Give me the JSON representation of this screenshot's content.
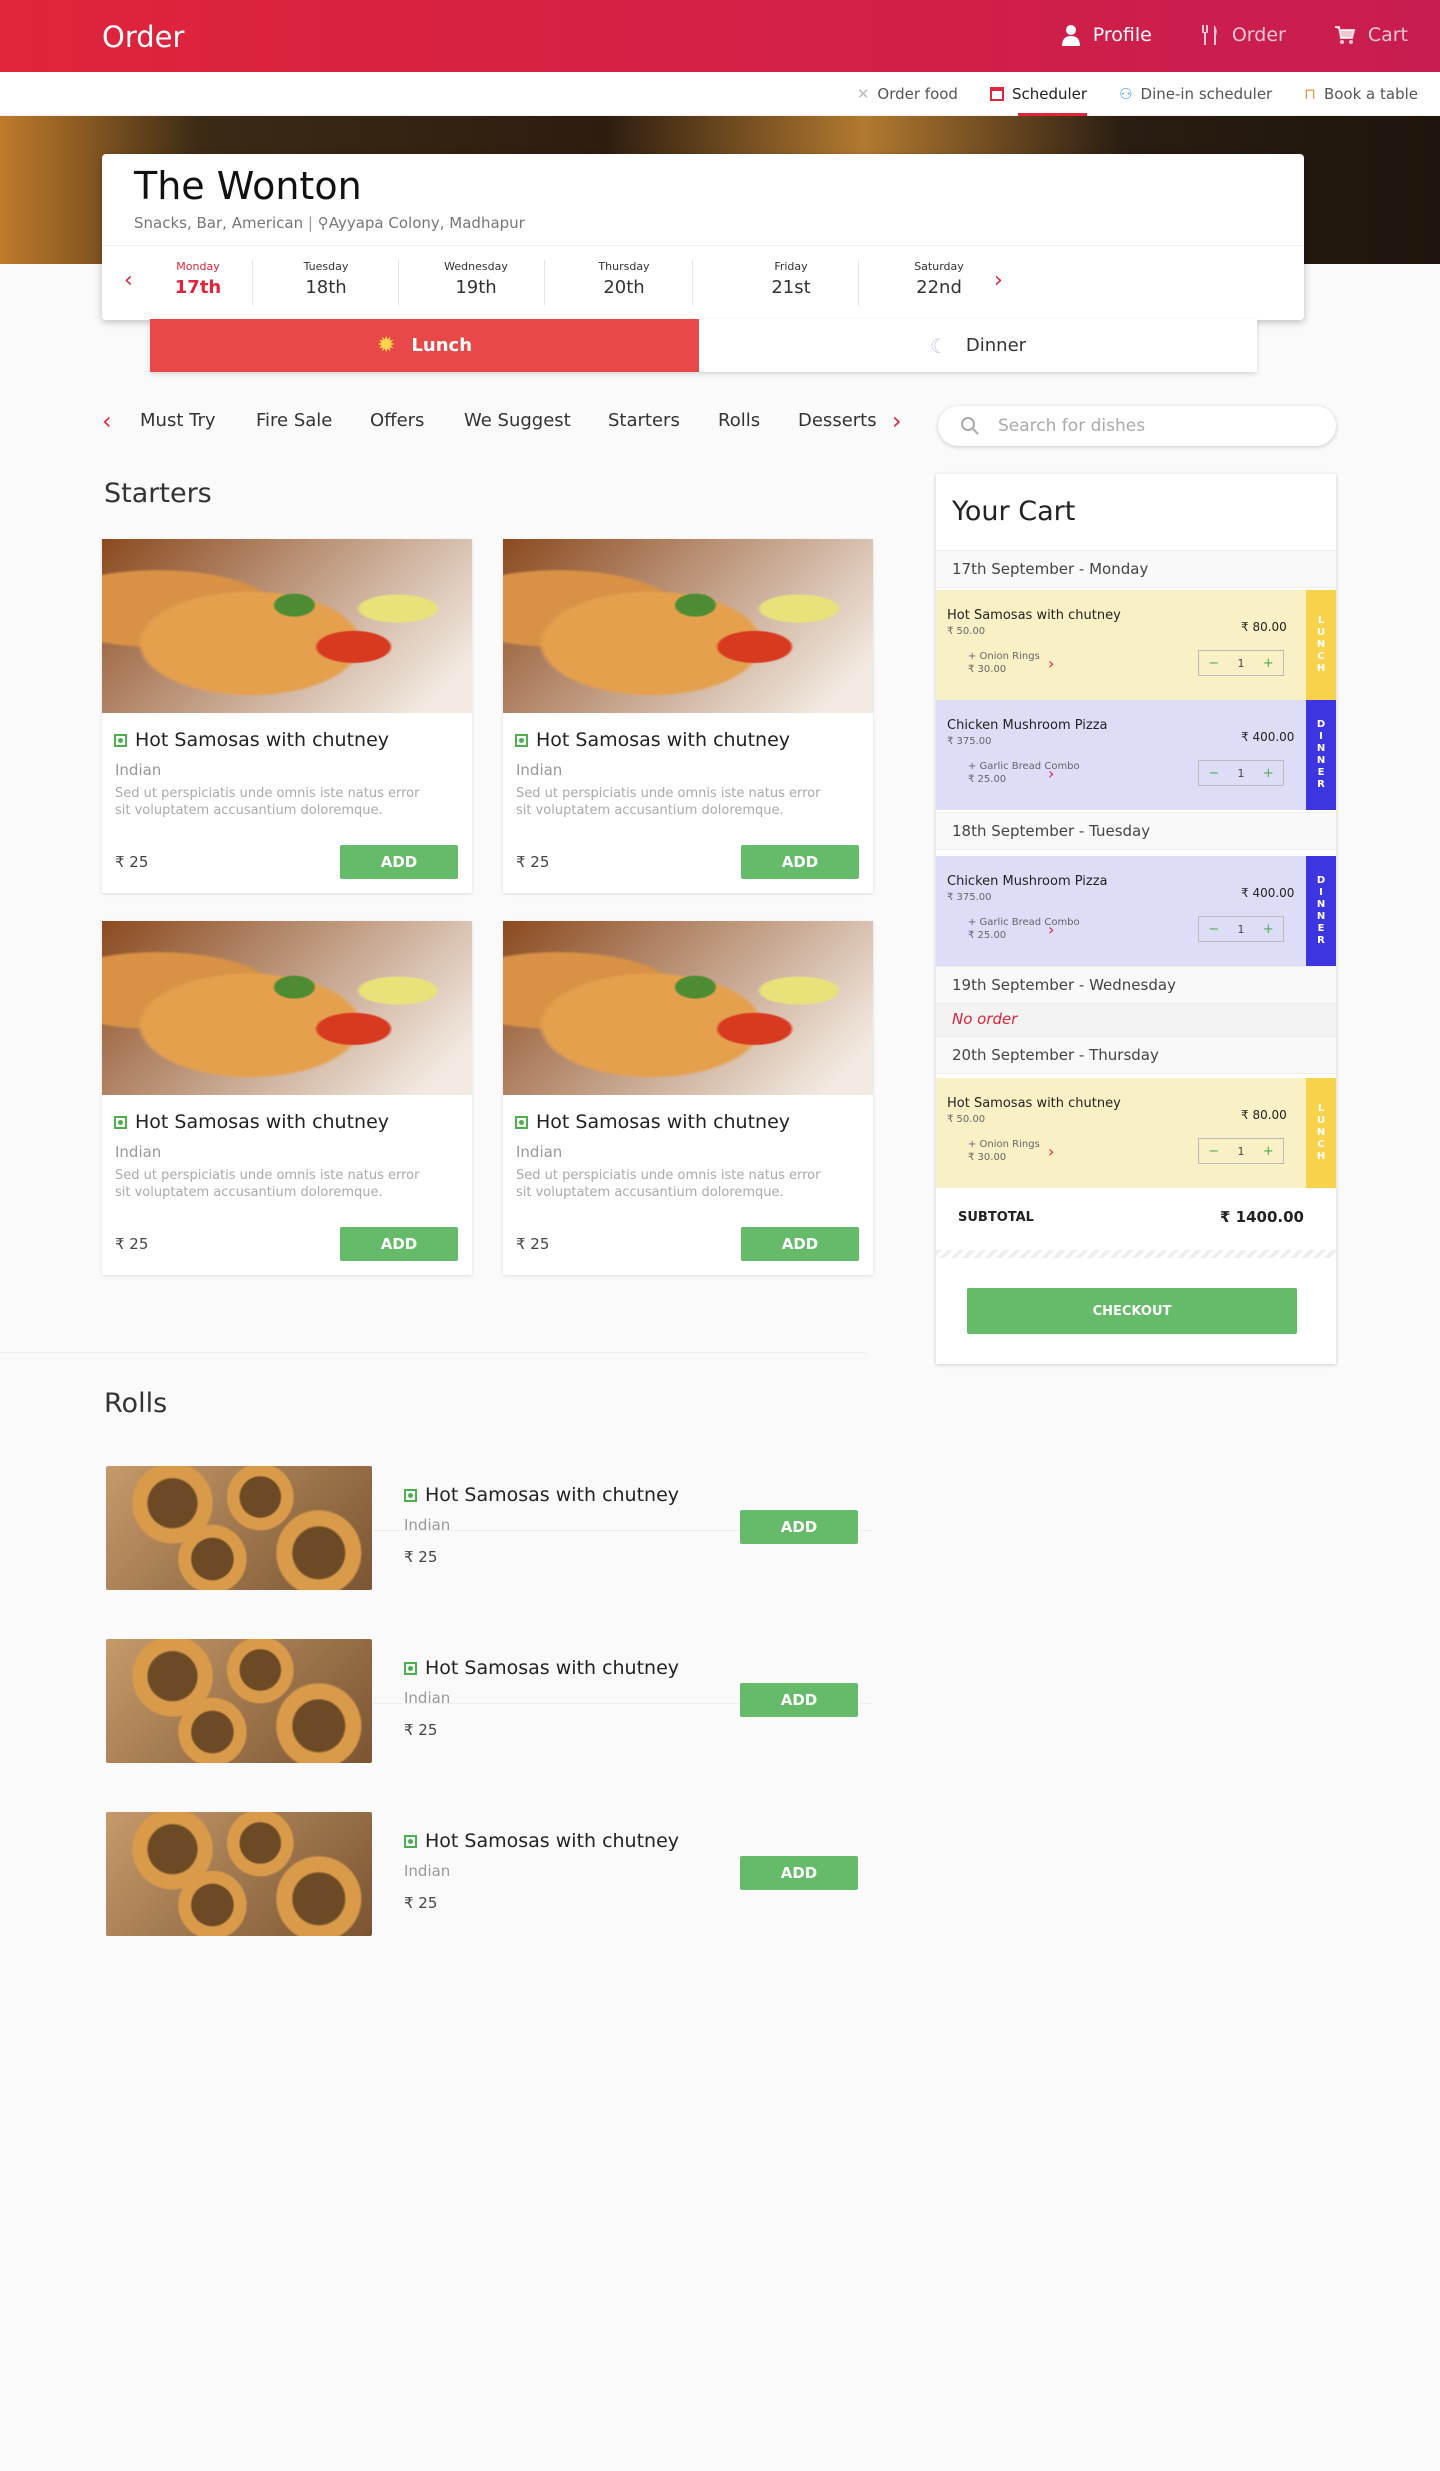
{
  "header": {
    "title": "Order",
    "nav": [
      {
        "label": "Profile",
        "icon": "user-icon"
      },
      {
        "label": "Order",
        "icon": "utensils-icon"
      },
      {
        "label": "Cart",
        "icon": "cart-icon"
      }
    ]
  },
  "subnav": [
    {
      "label": "Order food",
      "icon": "cutlery-icon"
    },
    {
      "label": "Scheduler",
      "icon": "calendar-icon"
    },
    {
      "label": "Dine-in scheduler",
      "icon": "dine-in-icon"
    },
    {
      "label": "Book a table",
      "icon": "table-icon"
    }
  ],
  "restaurant": {
    "name": "The Wonton",
    "tags": "Snacks, Bar, American",
    "location": "Ayyapa Colony, Madhapur"
  },
  "days": [
    {
      "name": "Monday",
      "date": "17th"
    },
    {
      "name": "Tuesday",
      "date": "18th"
    },
    {
      "name": "Wednesday",
      "date": "19th"
    },
    {
      "name": "Thursday",
      "date": "20th"
    },
    {
      "name": "Friday",
      "date": "21st"
    },
    {
      "name": "Saturday",
      "date": "22nd"
    }
  ],
  "meals": {
    "lunch": "Lunch",
    "dinner": "Dinner"
  },
  "categories": [
    "Must Try",
    "Fire Sale",
    "Offers",
    "We Suggest",
    "Starters",
    "Rolls",
    "Desserts"
  ],
  "search": {
    "placeholder": "Search for dishes"
  },
  "starters": {
    "title": "Starters",
    "dish": {
      "name": "Hot Samosas with chutney",
      "cuisine": "Indian",
      "desc": "Sed ut perspiciatis unde omnis iste natus error sit voluptatem accusantium doloremque.",
      "price": "₹ 25",
      "add": "ADD"
    }
  },
  "rolls": {
    "title": "Rolls",
    "dish": {
      "name": "Hot Samosas with chutney",
      "cuisine": "Indian",
      "price": "₹ 25",
      "add": "ADD"
    }
  },
  "cart": {
    "title": "Your Cart",
    "mon": "17th September - Monday",
    "tue": "18th September - Tuesday",
    "wed": "19th September - Wednesday",
    "thu": "20th September - Thursday",
    "no_order": "No order",
    "item_samosa": {
      "name": "Hot Samosas with chutney",
      "price": "₹ 50.00",
      "total": "₹ 80.00",
      "addon": "+ Onion Rings",
      "addon_price": "₹ 30.00",
      "qty": "1"
    },
    "item_pizza": {
      "name": "Chicken Mushroom Pizza",
      "price": "₹ 375.00",
      "total": "₹ 400.00",
      "addon": "+ Garlic Bread Combo",
      "addon_price": "₹ 25.00",
      "qty": "1"
    },
    "lunch_tag": "LUNCH",
    "dinner_tag": "DINNER",
    "lunch_color": "#f9f1c5",
    "lunch_tag_color": "#f7d24a",
    "dinner_color": "#ddddf8",
    "dinner_tag_color": "#3d35e0",
    "subtotal_label": "SUBTOTAL",
    "subtotal": "₹ 1400.00",
    "checkout": "CHECKOUT"
  }
}
